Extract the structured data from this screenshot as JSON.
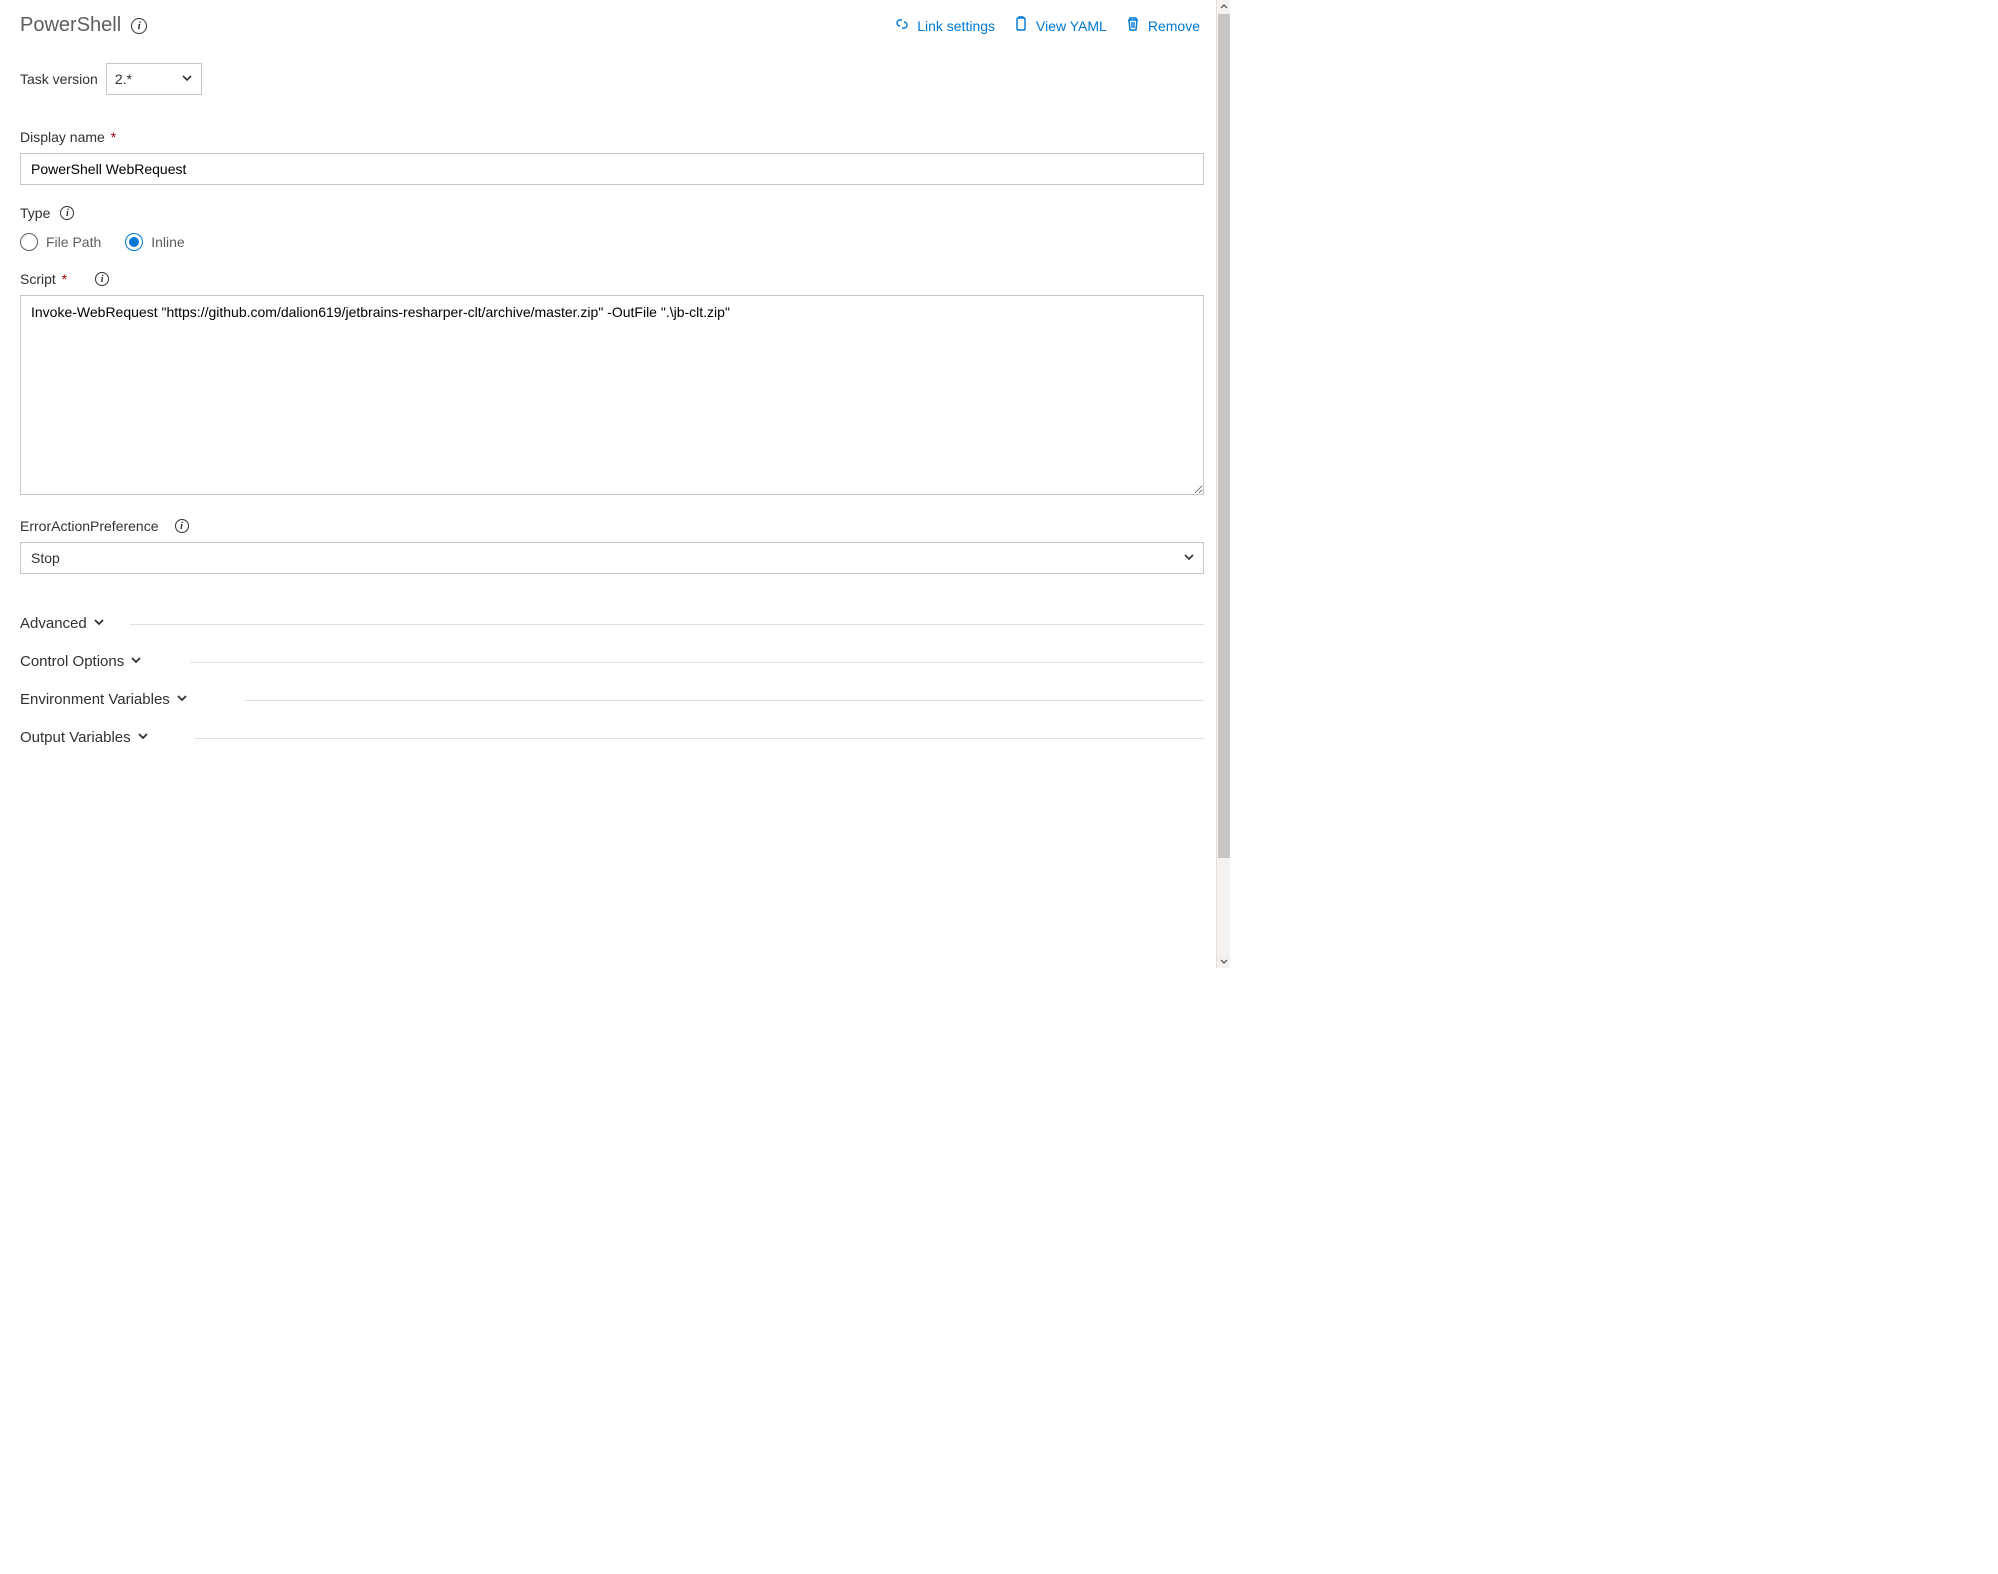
{
  "header": {
    "title": "PowerShell",
    "actions": {
      "link_settings": "Link settings",
      "view_yaml": "View YAML",
      "remove": "Remove"
    }
  },
  "task_version": {
    "label": "Task version",
    "value": "2.*"
  },
  "display_name": {
    "label": "Display name",
    "value": "PowerShell WebRequest"
  },
  "type": {
    "label": "Type",
    "options": {
      "file_path": "File Path",
      "inline": "Inline"
    },
    "selected": "inline"
  },
  "script": {
    "label": "Script",
    "value": "Invoke-WebRequest \"https://github.com/dalion619/jetbrains-resharper-clt/archive/master.zip\" -OutFile \".\\jb-clt.zip\""
  },
  "error_action": {
    "label": "ErrorActionPreference",
    "value": "Stop"
  },
  "sections": {
    "advanced": "Advanced",
    "control_options": "Control Options",
    "env_vars": "Environment Variables",
    "output_vars": "Output Variables"
  }
}
